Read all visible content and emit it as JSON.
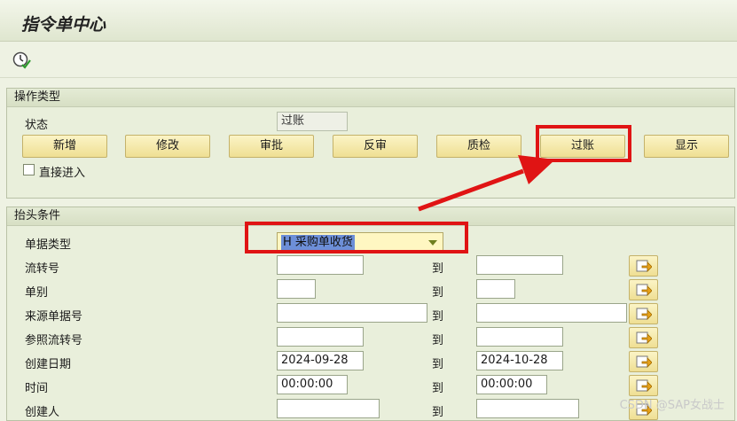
{
  "page_title": "指令单中心",
  "ops_group": {
    "title": "操作类型",
    "status_label": "状态",
    "status_value": "过账",
    "buttons": [
      "新增",
      "修改",
      "审批",
      "反审",
      "质检",
      "过账",
      "显示"
    ],
    "direct_entry_label": "直接进入"
  },
  "header_group": {
    "title": "抬头条件",
    "doc_type_label": "单据类型",
    "doc_type_value": "H 采购单收货",
    "to_label": "到",
    "rows": [
      {
        "label": "流转号",
        "from": "",
        "to": ""
      },
      {
        "label": "单别",
        "from": "",
        "to": ""
      },
      {
        "label": "来源单据号",
        "from": "",
        "to": ""
      },
      {
        "label": "参照流转号",
        "from": "",
        "to": ""
      },
      {
        "label": "创建日期",
        "from": "2024-09-28",
        "to": "2024-10-28"
      },
      {
        "label": "时间",
        "from": "00:00:00",
        "to": "00:00:00"
      },
      {
        "label": "创建人",
        "from": "",
        "to": ""
      }
    ]
  },
  "watermark": "CSDN @SAP女战士",
  "colors": {
    "highlight": "#e01414",
    "button": "#f4e9a8",
    "background": "#eef2e3"
  }
}
